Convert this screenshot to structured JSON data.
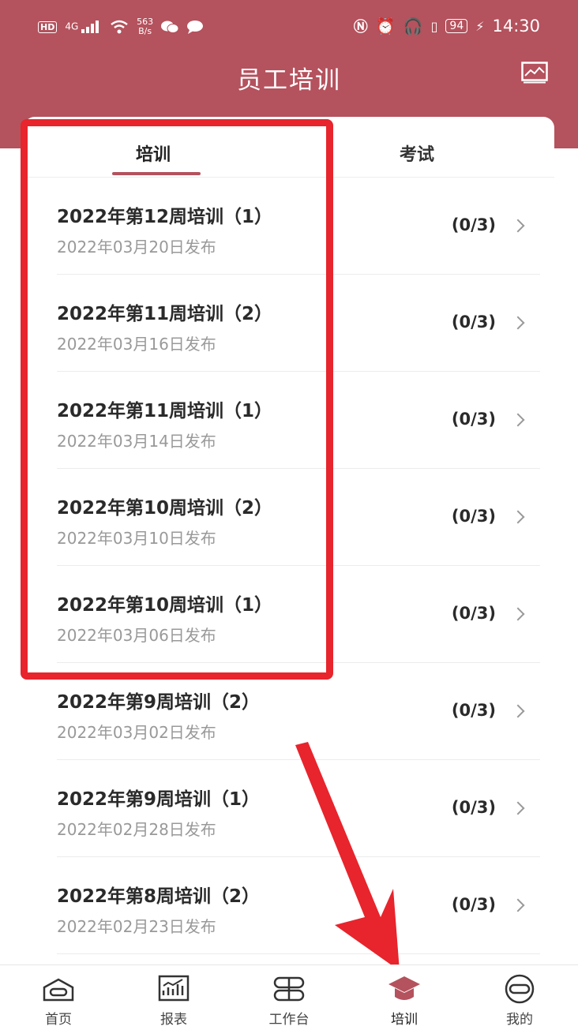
{
  "status_bar": {
    "hd": "HD",
    "network": "4G",
    "speed_value": "563",
    "speed_unit": "B/s",
    "battery": "94",
    "time": "14:30"
  },
  "header": {
    "title": "员工培训",
    "action_icon": "chart-icon"
  },
  "tabs": [
    {
      "label": "培训",
      "active": true
    },
    {
      "label": "考试",
      "active": false
    }
  ],
  "trainings": [
    {
      "title": "2022年第12周培训（1）",
      "date": "2022年03月20日发布",
      "progress": "(0/3)"
    },
    {
      "title": "2022年第11周培训（2）",
      "date": "2022年03月16日发布",
      "progress": "(0/3)"
    },
    {
      "title": "2022年第11周培训（1）",
      "date": "2022年03月14日发布",
      "progress": "(0/3)"
    },
    {
      "title": "2022年第10周培训（2）",
      "date": "2022年03月10日发布",
      "progress": "(0/3)"
    },
    {
      "title": "2022年第10周培训（1）",
      "date": "2022年03月06日发布",
      "progress": "(0/3)"
    },
    {
      "title": "2022年第9周培训（2）",
      "date": "2022年03月02日发布",
      "progress": "(0/3)"
    },
    {
      "title": "2022年第9周培训（1）",
      "date": "2022年02月28日发布",
      "progress": "(0/3)"
    },
    {
      "title": "2022年第8周培训（2）",
      "date": "2022年02月23日发布",
      "progress": "(0/3)"
    }
  ],
  "bottom_nav": [
    {
      "label": "首页",
      "icon": "home-icon",
      "active": false
    },
    {
      "label": "报表",
      "icon": "report-icon",
      "active": false
    },
    {
      "label": "工作台",
      "icon": "workbench-icon",
      "active": false
    },
    {
      "label": "培训",
      "icon": "graduation-cap-icon",
      "active": true
    },
    {
      "label": "我的",
      "icon": "profile-icon",
      "active": false
    }
  ],
  "colors": {
    "brand": "#b4525d",
    "highlight_box": "#e8242c",
    "arrow": "#e8242c"
  }
}
